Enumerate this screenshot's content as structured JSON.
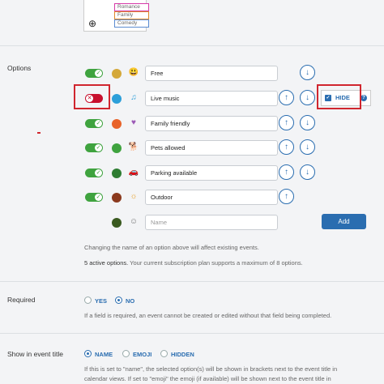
{
  "thumbnail": {
    "tags": [
      "Romance",
      "Family",
      "Comedy"
    ],
    "tag_colors": [
      "#d63aa8",
      "#e08a2a",
      "#5b8bd0"
    ]
  },
  "options": {
    "label": "Options",
    "rows": [
      {
        "name": "Free",
        "enabled": true,
        "color": "#d4a83a",
        "emoji": "😃",
        "up": false,
        "down": true
      },
      {
        "name": "Live music",
        "enabled": false,
        "color": "#2d9fd9",
        "emoji": "♫",
        "up": true,
        "down": true,
        "hide_label": "HIDE"
      },
      {
        "name": "Family friendly",
        "enabled": true,
        "color": "#e8632a",
        "emoji": "♥",
        "up": true,
        "down": true
      },
      {
        "name": "Pets allowed",
        "enabled": true,
        "color": "#3fa33f",
        "emoji": "🐕",
        "up": true,
        "down": true
      },
      {
        "name": "Parking available",
        "enabled": true,
        "color": "#2f7d32",
        "emoji": "🚗",
        "up": true,
        "down": true
      },
      {
        "name": "Outdoor",
        "enabled": true,
        "color": "#8b3a1e",
        "emoji": "☼",
        "up": true,
        "down": false
      }
    ],
    "new_row": {
      "placeholder": "Name",
      "add_label": "Add",
      "color": "#3a5a20",
      "emoji": "☺"
    },
    "note": "Changing the name of an option above will affect existing events.",
    "active_count": "5 active options.",
    "plan_note": "Your current subscription plan supports a maximum of 8 options."
  },
  "required": {
    "label": "Required",
    "yes": "YES",
    "no": "NO",
    "selected": "NO",
    "note": "If a field is required, an event cannot be created or edited without that field being completed."
  },
  "event_title": {
    "label": "Show in event title",
    "options": [
      "NAME",
      "EMOJI",
      "HIDDEN"
    ],
    "selected": "NAME",
    "note1": "If this is set to \"name\", the selected option(s) will be shown in brackets next to the event title in",
    "note2": "calendar views. If set to \"emoji\" the emoji (if available) will be shown next to the event title in"
  }
}
